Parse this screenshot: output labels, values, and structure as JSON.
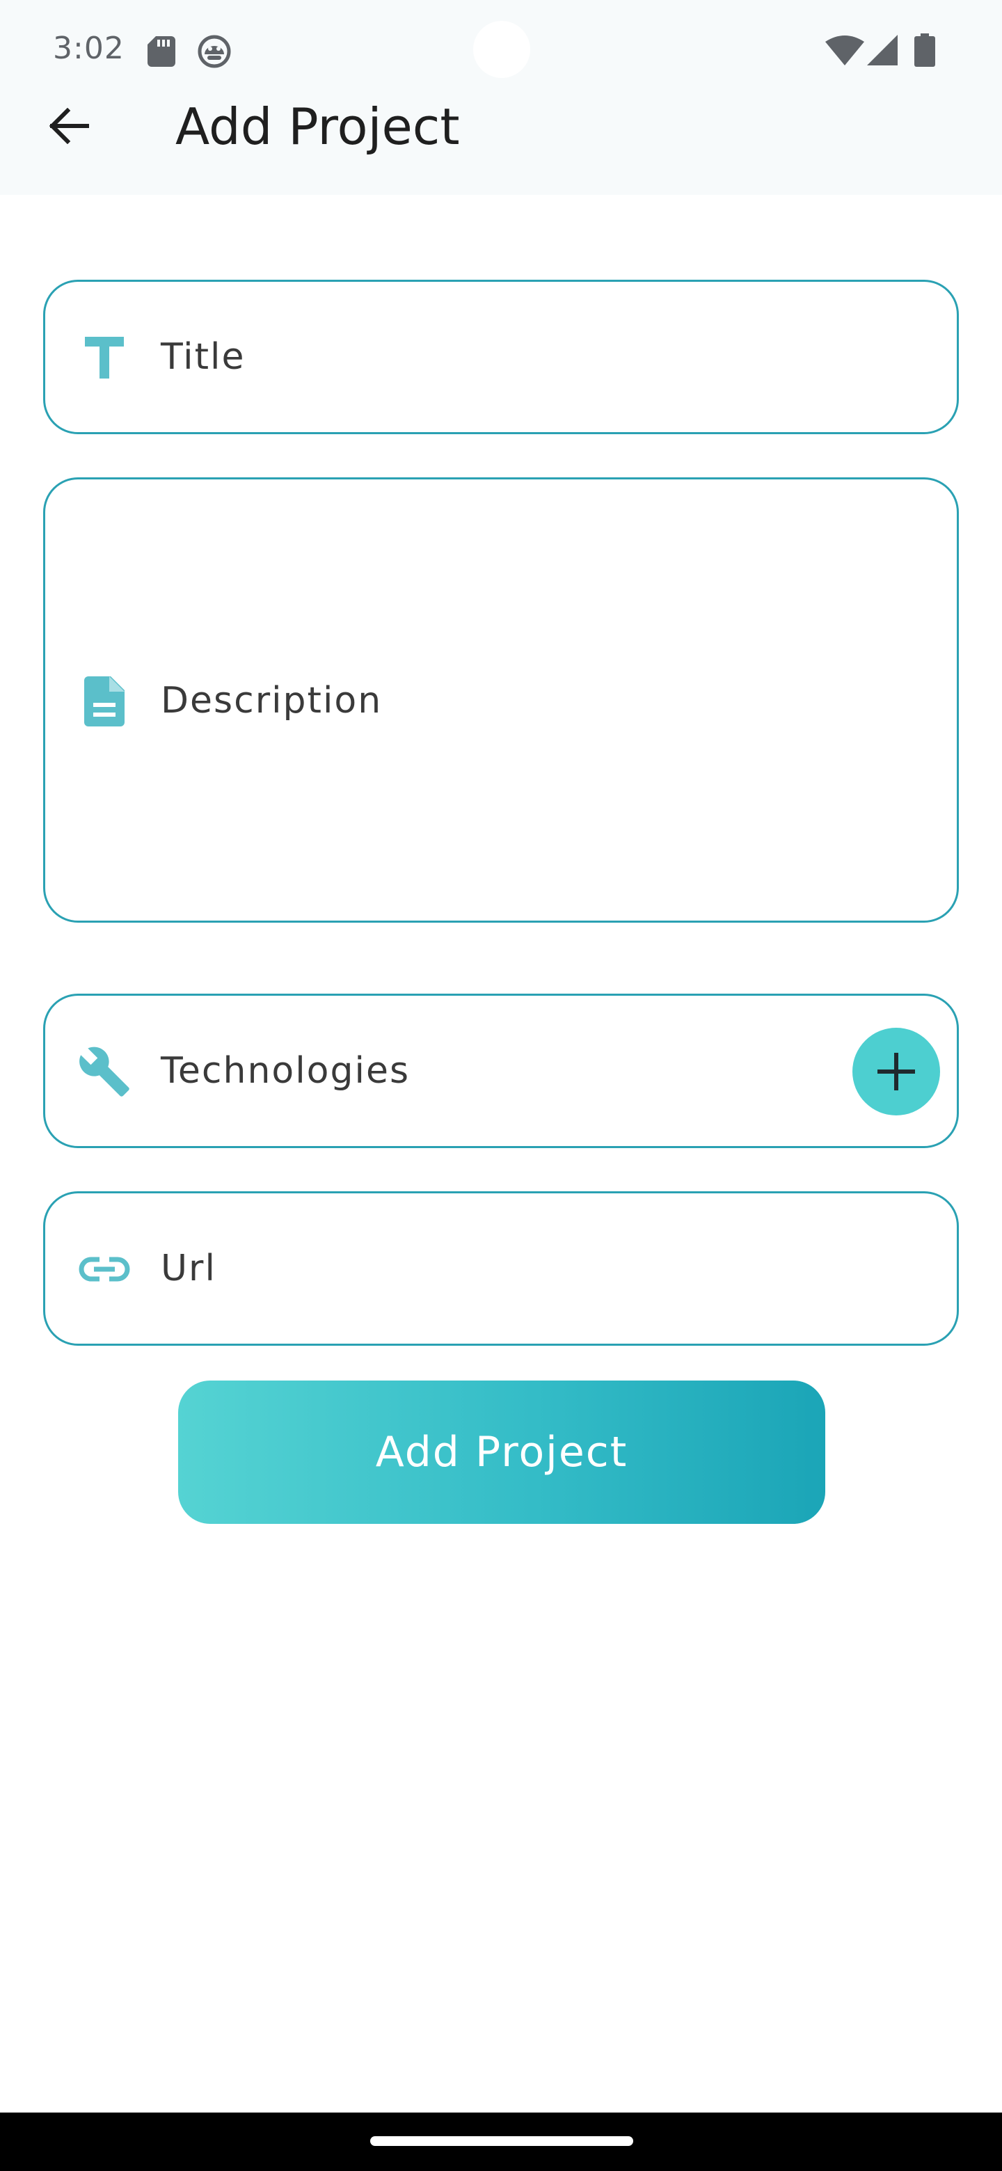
{
  "status_bar": {
    "time": "3:02",
    "icons": [
      "sd-card-icon",
      "android-debug-icon",
      "wifi-icon",
      "cellular-signal-icon",
      "battery-icon"
    ]
  },
  "app_bar": {
    "title": "Add Project",
    "back_icon": "arrow-back-icon"
  },
  "form": {
    "title_field": {
      "label": "Title",
      "icon": "title-text-icon"
    },
    "description_field": {
      "label": "Description",
      "icon": "document-icon"
    },
    "technologies_field": {
      "label": "Technologies",
      "icon": "wrench-icon",
      "add_icon": "plus-icon"
    },
    "url_field": {
      "label": "Url",
      "icon": "link-icon"
    },
    "submit_label": "Add Project"
  },
  "colors": {
    "border": "#2aa1b3",
    "icon_accent": "#5bbfca",
    "fab": "#4dcfd0",
    "gradient_start": "#55d3d3",
    "gradient_end": "#1ba5b7",
    "appbar_bg": "#f7fafb"
  }
}
